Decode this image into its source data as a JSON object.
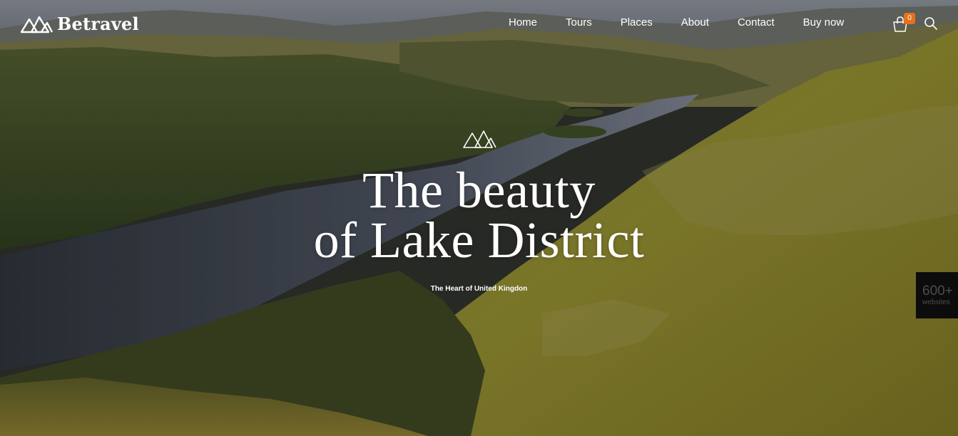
{
  "header": {
    "logo": {
      "icon": "mountains-icon",
      "text": "Betravel"
    },
    "nav": [
      {
        "label": "Home"
      },
      {
        "label": "Tours"
      },
      {
        "label": "Places"
      },
      {
        "label": "About"
      },
      {
        "label": "Contact"
      },
      {
        "label": "Buy now"
      }
    ],
    "cart": {
      "icon": "shopping-bag-icon",
      "count": "0"
    },
    "search": {
      "icon": "search-icon"
    }
  },
  "hero": {
    "emblem": "mountains-icon",
    "title_line1": "The beauty",
    "title_line2": "of Lake District",
    "subtitle": "The Heart of United Kingdon"
  },
  "promo": {
    "count": "600+",
    "label": "websites"
  },
  "colors": {
    "accent": "#e8701a",
    "text": "#ffffff",
    "promo_bg": "#0c0c0c"
  }
}
